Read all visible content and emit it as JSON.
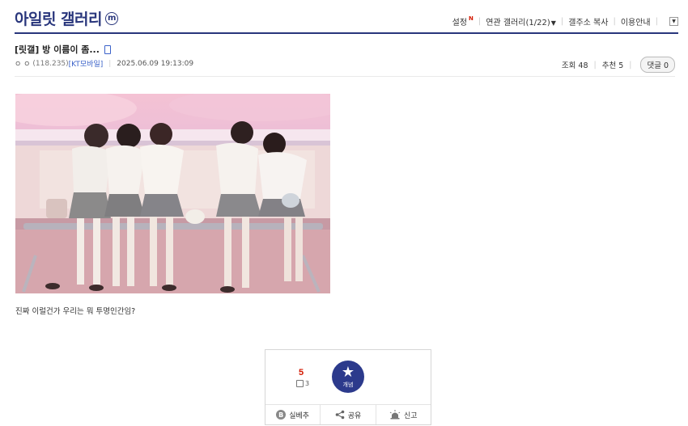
{
  "header": {
    "gallery_name": "아일릿 갤러리",
    "minor_badge": "m",
    "links": {
      "settings": "설정",
      "new_badge": "N",
      "related_galleries": "연관 갤러리(1/22)",
      "copy_address": "갤주소 복사",
      "usage_guide": "이용안내"
    }
  },
  "post": {
    "title": "[릿갤] 방 이름이 좀...",
    "author": "ㅇ ㅇ",
    "ip": "(118.235)",
    "carrier": "[KT모바일]",
    "datetime": "2025.06.09 19:13:09",
    "views_label": "조회 48",
    "recommend_label": "추천 5",
    "reply_label": "댓글 0",
    "body_text": "진짜 이럴건가 우리는 뭐 투명인간임?"
  },
  "vote": {
    "count": "5",
    "fixed_count": "3",
    "upvote_label": "개념",
    "actions": {
      "down": "실베추",
      "share": "공유",
      "report": "신고"
    }
  },
  "colors": {
    "brand": "#29367c",
    "upvote_button": "#2c3a8c",
    "vote_count": "#d31900",
    "carrier": "#3b62c9"
  },
  "icons": [
    "mobile-icon",
    "star-icon",
    "share-icon",
    "siren-icon",
    "b-icon",
    "chevron-down-icon"
  ]
}
